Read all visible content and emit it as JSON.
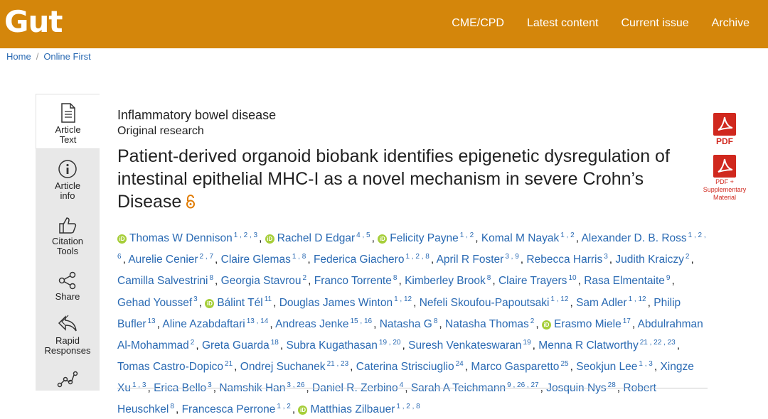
{
  "header": {
    "logo": "Gut",
    "nav": [
      "CME/CPD",
      "Latest content",
      "Current issue",
      "Archive"
    ]
  },
  "breadcrumb": {
    "home": "Home",
    "sep": "/",
    "current": "Online First"
  },
  "sidebar": {
    "items": [
      {
        "label": "Article Text",
        "icon": "document-icon"
      },
      {
        "label": "Article info",
        "icon": "info-icon"
      },
      {
        "label": "Citation Tools",
        "icon": "thumbs-up-icon"
      },
      {
        "label": "Share",
        "icon": "share-icon"
      },
      {
        "label": "Rapid Responses",
        "icon": "reply-icon"
      }
    ]
  },
  "article": {
    "category": "Inflammatory bowel disease",
    "type": "Original research",
    "title": "Patient-derived organoid biobank identifies epigenetic dysregulation of intestinal epithelial MHC-I as a novel mechanism in severe Crohn’s Disease",
    "open_access_icon": "open-lock-icon"
  },
  "downloads": {
    "pdf": "PDF",
    "pdf_supp": "PDF + Supplementary Material"
  },
  "authors": [
    {
      "name": "Thomas W Dennison",
      "sup": "1 , 2 , 3",
      "orcid": true
    },
    {
      "name": "Rachel D Edgar",
      "sup": "4 , 5",
      "orcid": true
    },
    {
      "name": "Felicity Payne",
      "sup": "1 , 2",
      "orcid": true
    },
    {
      "name": "Komal M Nayak",
      "sup": "1 , 2"
    },
    {
      "name": "Alexander D. B. Ross",
      "sup": "1 , 2 , 6"
    },
    {
      "name": "Aurelie Cenier",
      "sup": "2 , 7"
    },
    {
      "name": "Claire Glemas",
      "sup": "1 , 8"
    },
    {
      "name": "Federica Giachero",
      "sup": "1 , 2 , 8"
    },
    {
      "name": "April R Foster",
      "sup": "3 , 9"
    },
    {
      "name": "Rebecca Harris",
      "sup": "3"
    },
    {
      "name": "Judith Kraiczy",
      "sup": "2"
    },
    {
      "name": "Camilla Salvestrini",
      "sup": "8"
    },
    {
      "name": "Georgia Stavrou",
      "sup": "2"
    },
    {
      "name": "Franco Torrente",
      "sup": "8"
    },
    {
      "name": "Kimberley Brook",
      "sup": "8"
    },
    {
      "name": "Claire Trayers",
      "sup": "10"
    },
    {
      "name": "Rasa Elmentaite",
      "sup": "9"
    },
    {
      "name": "Gehad Youssef",
      "sup": "3"
    },
    {
      "name": "Bálint Tél",
      "sup": "11",
      "orcid": true
    },
    {
      "name": "Douglas James Winton",
      "sup": "1 , 12"
    },
    {
      "name": "Nefeli Skoufou-Papoutsaki",
      "sup": "1 , 12"
    },
    {
      "name": "Sam Adler",
      "sup": "1 , 12"
    },
    {
      "name": "Philip Bufler",
      "sup": "13"
    },
    {
      "name": "Aline Azabdaftari",
      "sup": "13 , 14"
    },
    {
      "name": "Andreas Jenke",
      "sup": "15 , 16"
    },
    {
      "name": "Natasha G",
      "sup": "8"
    },
    {
      "name": "Natasha Thomas",
      "sup": "2"
    },
    {
      "name": "Erasmo Miele",
      "sup": "17",
      "orcid": true
    },
    {
      "name": "Abdulrahman Al-Mohammad",
      "sup": "2"
    },
    {
      "name": "Greta Guarda",
      "sup": "18"
    },
    {
      "name": "Subra Kugathasan",
      "sup": "19 , 20"
    },
    {
      "name": "Suresh Venkateswaran",
      "sup": "19"
    },
    {
      "name": "Menna R Clatworthy",
      "sup": "21 , 22 , 23"
    },
    {
      "name": "Tomas Castro-Dopico",
      "sup": "21"
    },
    {
      "name": "Ondrej Suchanek",
      "sup": "21 , 23"
    },
    {
      "name": "Caterina Strisciuglio",
      "sup": "24"
    },
    {
      "name": "Marco Gasparetto",
      "sup": "25"
    },
    {
      "name": "Seokjun Lee",
      "sup": "1 , 3"
    },
    {
      "name": "Xingze Xu",
      "sup": "1 , 3"
    },
    {
      "name": "Erica Bello",
      "sup": "3"
    },
    {
      "name": "Namshik Han",
      "sup": "3 , 26"
    },
    {
      "name": "Daniel R. Zerbino",
      "sup": "4"
    },
    {
      "name": "Sarah A Teichmann",
      "sup": "9 , 26 , 27"
    },
    {
      "name": "Josquin Nys",
      "sup": "28"
    },
    {
      "name": "Robert Heuschkel",
      "sup": "8"
    },
    {
      "name": "Francesca Perrone",
      "sup": "1 , 2"
    },
    {
      "name": "Matthias Zilbauer",
      "sup": "1 , 2 , 8",
      "orcid": true
    }
  ],
  "colors": {
    "brand": "#d4860b",
    "link": "#2a6ab3",
    "pdf": "#d0281e",
    "orcid": "#a6ce39"
  }
}
